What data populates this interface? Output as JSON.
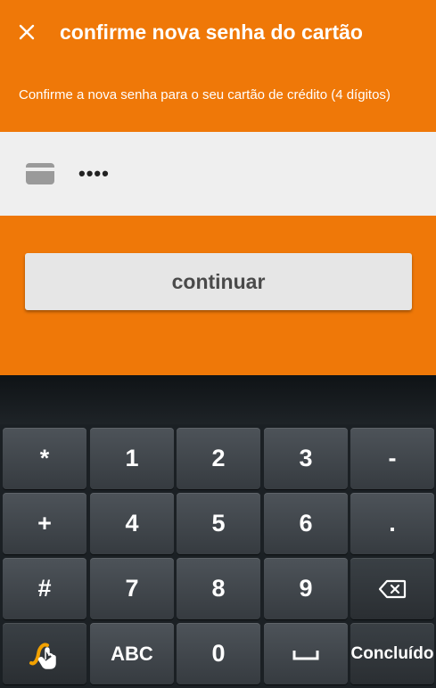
{
  "header": {
    "title": "confirme nova senha do cartão",
    "close_icon": "close-icon"
  },
  "instructions": "Confirme a nova senha para o seu cartão de crédito (4 dígitos)",
  "pin_field": {
    "icon": "credit-card-icon",
    "masked_value": "••••"
  },
  "continue_label": "continuar",
  "colors": {
    "brand_orange": "#ef7808",
    "field_bg": "#efefef",
    "button_bg": "#e6e6e6",
    "keyboard_bg": "#1b2024"
  },
  "keyboard": {
    "row1": [
      "*",
      "1",
      "2",
      "3",
      "-"
    ],
    "row2": [
      "+",
      "4",
      "5",
      "6",
      "."
    ],
    "row3": [
      "#",
      "7",
      "8",
      "9"
    ],
    "backspace_icon": "backspace-icon",
    "row4": {
      "swype_icon": "swype-gesture-icon",
      "abc": "ABC",
      "zero": "0",
      "space_icon": "space-bar-icon",
      "done": "Concluído"
    }
  }
}
